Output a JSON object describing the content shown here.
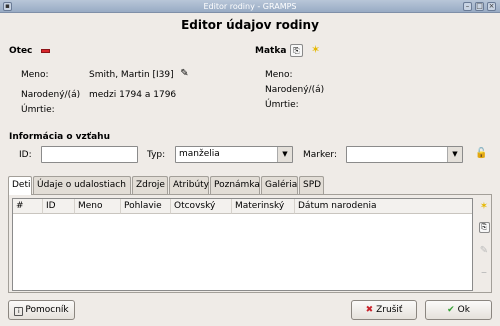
{
  "window": {
    "title": "Editor rodiny - GRAMPS"
  },
  "header": {
    "title": "Editor údajov rodiny"
  },
  "father": {
    "section_label": "Otec",
    "name_label": "Meno:",
    "name_value": "Smith, Martin [I39]",
    "born_label": "Narodený/(á)",
    "born_value": "medzi 1794 a 1796",
    "died_label": "Úmrtie:"
  },
  "mother": {
    "section_label": "Matka",
    "name_label": "Meno:",
    "born_label": "Narodený/(á)",
    "died_label": "Úmrtie:"
  },
  "relationship": {
    "section_label": "Informácia o vzťahu",
    "id_label": "ID:",
    "id_value": "",
    "type_label": "Typ:",
    "type_value": "manželia",
    "marker_label": "Marker:",
    "marker_value": ""
  },
  "tabs": [
    {
      "label": "Deti",
      "active": true
    },
    {
      "label": "Údaje o udalostiach"
    },
    {
      "label": "Zdroje"
    },
    {
      "label": "Atribúty"
    },
    {
      "label": "Poznámka"
    },
    {
      "label": "Galéria"
    },
    {
      "label": "SPD"
    }
  ],
  "columns": [
    "#",
    "ID",
    "Meno",
    "Pohlavie",
    "Otcovský",
    "Materinský",
    "Dátum narodenia"
  ],
  "buttons": {
    "help": "Pomocník",
    "cancel": "Zrušiť",
    "ok": "Ok"
  },
  "colors": {
    "accent_red": "#d9262c",
    "star": "#e6b800",
    "ok_green": "#2e9e2e"
  }
}
